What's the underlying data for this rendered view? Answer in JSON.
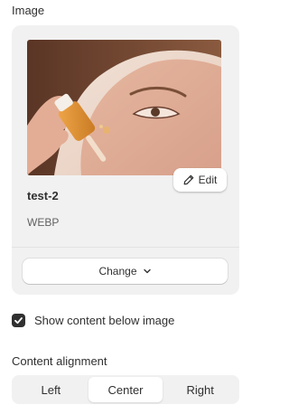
{
  "image_section": {
    "label": "Image",
    "edit_label": "Edit",
    "file_name": "test-2",
    "file_type": "WEBP",
    "change_label": "Change"
  },
  "options": {
    "show_content_below_image": {
      "label": "Show content below image",
      "checked": true
    }
  },
  "content_alignment": {
    "label": "Content alignment",
    "options": [
      "Left",
      "Center",
      "Right"
    ],
    "selected": "Center"
  },
  "icons": {
    "edit": "pencil-icon",
    "change": "chevron-down-icon",
    "checkbox": "checkmark-icon"
  },
  "colors": {
    "card_background": "#f1f1f1",
    "checkbox_fill": "#303030",
    "text": "#303030"
  }
}
